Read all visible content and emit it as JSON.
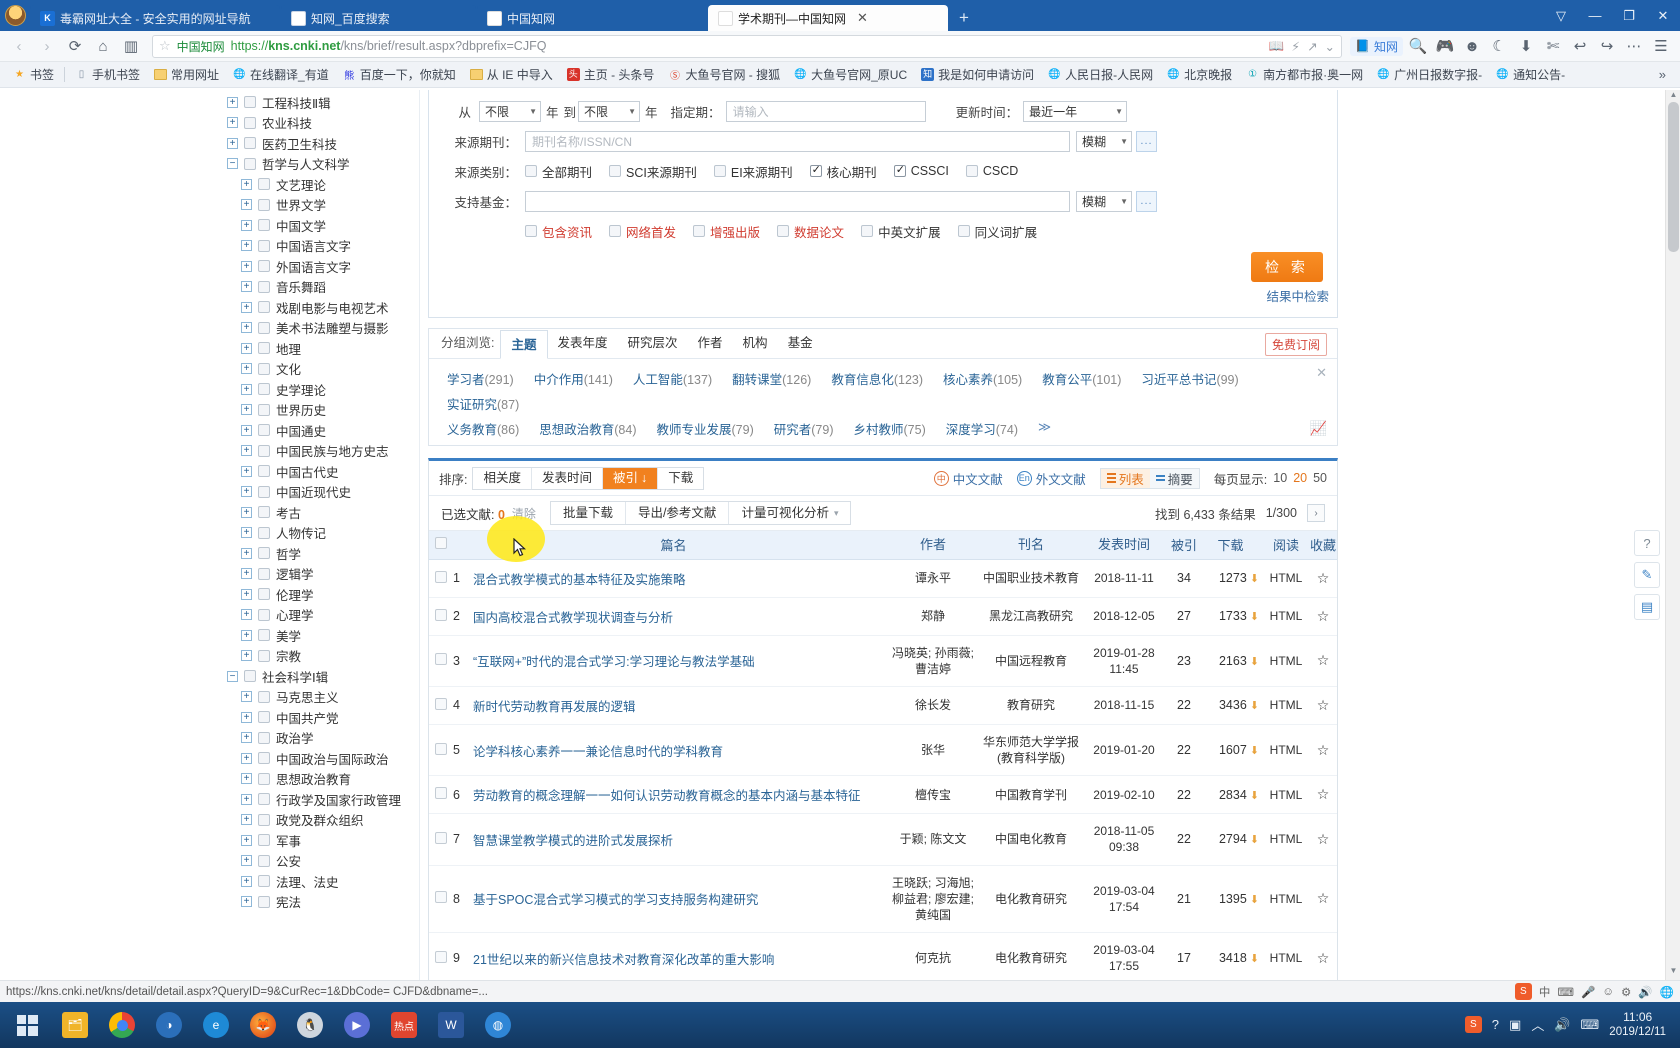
{
  "browser": {
    "tabs": [
      {
        "title": "毒霸网址大全 - 安全实用的网址导航",
        "favicon": "K",
        "active": false
      },
      {
        "title": "知网_百度搜索",
        "favicon": "百",
        "active": false
      },
      {
        "title": "中国知网",
        "favicon": "知",
        "active": false
      },
      {
        "title": "学术期刊—中国知网",
        "favicon": "知",
        "active": true
      }
    ],
    "newtab_label": "+",
    "window_buttons": [
      "⬒",
      "—",
      "❐",
      "✕"
    ],
    "nav": {
      "back": "‹",
      "forward": "›",
      "reload": "⟳",
      "home": "⌂",
      "reader": "▥",
      "star": "☆",
      "site_label": "中国知网",
      "url_scheme": "https://",
      "url_host": "kns.cnki.net",
      "url_path": "/kns/brief/result.aspx?dbprefix=CJFQ",
      "badge_label": "知网",
      "right_icons": [
        "📖",
        "⚡",
        "↗",
        "⌄",
        "🔍",
        "🎮",
        "☻",
        "☾",
        "⬇",
        "✄",
        "↩",
        "↪",
        "⋯",
        "☰"
      ]
    },
    "bookmarks": [
      {
        "label": "书签",
        "icon": "star"
      },
      {
        "label": "手机书签",
        "icon": "phone"
      },
      {
        "label": "常用网址",
        "icon": "folder"
      },
      {
        "label": "在线翻译_有道",
        "icon": "globe"
      },
      {
        "label": "百度一下，你就知",
        "icon": "baidu"
      },
      {
        "label": "从 IE 中导入",
        "icon": "folder"
      },
      {
        "label": "主页 - 头条号",
        "icon": "toutiao"
      },
      {
        "label": "大鱼号官网 - 搜狐",
        "icon": "dayu"
      },
      {
        "label": "大鱼号官网_原UC",
        "icon": "globe"
      },
      {
        "label": "我是如何申请访问",
        "icon": "zhi"
      },
      {
        "label": "人民日报-人民网",
        "icon": "globe"
      },
      {
        "label": "北京晚报",
        "icon": "globe"
      },
      {
        "label": "南方都市报·奥一网",
        "icon": "nandu"
      },
      {
        "label": "广州日报数字报-",
        "icon": "globe"
      },
      {
        "label": "通知公告-",
        "icon": "globe"
      }
    ],
    "bookmarks_overflow": "»"
  },
  "tree": {
    "items": [
      {
        "label": "工程科技Ⅱ辑",
        "level": 0,
        "expander": "+",
        "clipped": true
      },
      {
        "label": "农业科技",
        "level": 0,
        "expander": "+"
      },
      {
        "label": "医药卫生科技",
        "level": 0,
        "expander": "+"
      },
      {
        "label": "哲学与人文科学",
        "level": 0,
        "expander": "−"
      },
      {
        "label": "文艺理论",
        "level": 1,
        "expander": "+"
      },
      {
        "label": "世界文学",
        "level": 1,
        "expander": "+"
      },
      {
        "label": "中国文学",
        "level": 1,
        "expander": "+"
      },
      {
        "label": "中国语言文字",
        "level": 1,
        "expander": "+"
      },
      {
        "label": "外国语言文字",
        "level": 1,
        "expander": "+"
      },
      {
        "label": "音乐舞蹈",
        "level": 1,
        "expander": "+"
      },
      {
        "label": "戏剧电影与电视艺术",
        "level": 1,
        "expander": "+"
      },
      {
        "label": "美术书法雕塑与摄影",
        "level": 1,
        "expander": "+"
      },
      {
        "label": "地理",
        "level": 1,
        "expander": "+"
      },
      {
        "label": "文化",
        "level": 1,
        "expander": "+"
      },
      {
        "label": "史学理论",
        "level": 1,
        "expander": "+"
      },
      {
        "label": "世界历史",
        "level": 1,
        "expander": "+"
      },
      {
        "label": "中国通史",
        "level": 1,
        "expander": "+"
      },
      {
        "label": "中国民族与地方史志",
        "level": 1,
        "expander": "+"
      },
      {
        "label": "中国古代史",
        "level": 1,
        "expander": "+"
      },
      {
        "label": "中国近现代史",
        "level": 1,
        "expander": "+"
      },
      {
        "label": "考古",
        "level": 1,
        "expander": "+"
      },
      {
        "label": "人物传记",
        "level": 1,
        "expander": "+"
      },
      {
        "label": "哲学",
        "level": 1,
        "expander": "+"
      },
      {
        "label": "逻辑学",
        "level": 1,
        "expander": "+"
      },
      {
        "label": "伦理学",
        "level": 1,
        "expander": "+"
      },
      {
        "label": "心理学",
        "level": 1,
        "expander": "+"
      },
      {
        "label": "美学",
        "level": 1,
        "expander": "+"
      },
      {
        "label": "宗教",
        "level": 1,
        "expander": "+"
      },
      {
        "label": "社会科学Ⅰ辑",
        "level": 0,
        "expander": "−"
      },
      {
        "label": "马克思主义",
        "level": 1,
        "expander": "+"
      },
      {
        "label": "中国共产党",
        "level": 1,
        "expander": "+"
      },
      {
        "label": "政治学",
        "level": 1,
        "expander": "+"
      },
      {
        "label": "中国政治与国际政治",
        "level": 1,
        "expander": "+"
      },
      {
        "label": "思想政治教育",
        "level": 1,
        "expander": "+"
      },
      {
        "label": "行政学及国家行政管理",
        "level": 1,
        "expander": "+"
      },
      {
        "label": "政党及群众组织",
        "level": 1,
        "expander": "+"
      },
      {
        "label": "军事",
        "level": 1,
        "expander": "+"
      },
      {
        "label": "公安",
        "level": 1,
        "expander": "+"
      },
      {
        "label": "法理、法史",
        "level": 1,
        "expander": "+"
      },
      {
        "label": "宪法",
        "level": 1,
        "expander": "+"
      }
    ]
  },
  "search_form": {
    "from_label": "从",
    "from_value": "不限",
    "year_label_1": "年",
    "to_label": "到",
    "to_value": "不限",
    "year_label_2": "年",
    "issue_label": "指定期：",
    "issue_placeholder": "请输入",
    "update_label": "更新时间：",
    "update_value": "最近一年",
    "journal_label": "来源期刊：",
    "journal_placeholder": "期刊名称/ISSN/CN",
    "journal_match": "模糊",
    "category_label": "来源类别：",
    "categories": [
      {
        "label": "全部期刊",
        "checked": false
      },
      {
        "label": "SCI来源期刊",
        "checked": false
      },
      {
        "label": "EI来源期刊",
        "checked": false
      },
      {
        "label": "核心期刊",
        "checked": true
      },
      {
        "label": "CSSCI",
        "checked": true
      },
      {
        "label": "CSCD",
        "checked": false
      }
    ],
    "fund_label": "支持基金：",
    "fund_value": "",
    "fund_match": "模糊",
    "options": [
      {
        "label": "包含资讯",
        "checked": false,
        "red": true
      },
      {
        "label": "网络首发",
        "checked": false,
        "red": true
      },
      {
        "label": "增强出版",
        "checked": false,
        "red": true
      },
      {
        "label": "数据论文",
        "checked": false,
        "red": true
      },
      {
        "label": "中英文扩展",
        "checked": false,
        "red": false
      },
      {
        "label": "同义词扩展",
        "checked": false,
        "red": false
      }
    ],
    "search_button": "检 索",
    "refine_link": "结果中检索",
    "dots_label": "..."
  },
  "group_browse": {
    "label": "分组浏览:",
    "tabs": [
      {
        "label": "主题",
        "active": true
      },
      {
        "label": "发表年度",
        "active": false
      },
      {
        "label": "研究层次",
        "active": false
      },
      {
        "label": "作者",
        "active": false
      },
      {
        "label": "机构",
        "active": false
      },
      {
        "label": "基金",
        "active": false
      }
    ],
    "subscribe_label": "免费订阅",
    "close_icon": "✕",
    "chart_icon": "📈",
    "tags": [
      {
        "name": "学习者",
        "count": "(291)"
      },
      {
        "name": "中介作用",
        "count": "(141)"
      },
      {
        "name": "人工智能",
        "count": "(137)"
      },
      {
        "name": "翻转课堂",
        "count": "(126)"
      },
      {
        "name": "教育信息化",
        "count": "(123)"
      },
      {
        "name": "核心素养",
        "count": "(105)"
      },
      {
        "name": "教育公平",
        "count": "(101)"
      },
      {
        "name": "习近平总书记",
        "count": "(99)"
      },
      {
        "name": "实证研究",
        "count": "(87)"
      },
      {
        "name": "义务教育",
        "count": "(86)"
      },
      {
        "name": "思想政治教育",
        "count": "(84)"
      },
      {
        "name": "教师专业发展",
        "count": "(79)"
      },
      {
        "name": "研究者",
        "count": "(79)"
      },
      {
        "name": "乡村教师",
        "count": "(75)"
      },
      {
        "name": "深度学习",
        "count": "(74)"
      }
    ],
    "more": "≫"
  },
  "results_toolbar": {
    "sort_label": "排序:",
    "sort_options": [
      {
        "label": "相关度",
        "active": false
      },
      {
        "label": "发表时间",
        "active": false
      },
      {
        "label": "被引",
        "active": true,
        "arrow": "↓"
      },
      {
        "label": "下载",
        "active": false
      }
    ],
    "lang_cn": "中文文献",
    "lang_cn_icon": "中",
    "lang_en": "外文文献",
    "lang_en_icon": "En",
    "view_list": "列表",
    "view_abstract": "摘要",
    "perpage_label": "每页显示:",
    "perpage_options": [
      {
        "label": "10",
        "active": false
      },
      {
        "label": "20",
        "active": true
      },
      {
        "label": "50",
        "active": false
      }
    ]
  },
  "action_bar": {
    "selected_label": "已选文献:",
    "selected_count": "0",
    "clear_label": "清除",
    "batch_download": "批量下载",
    "export": "导出/参考文献",
    "analysis": "计量可视化分析",
    "analysis_caret": "▾",
    "found_label": "找到 6,433 条结果",
    "page_label": "1/300",
    "next_page": "›"
  },
  "table": {
    "headers": {
      "title": "篇名",
      "author": "作者",
      "journal": "刊名",
      "date": "发表时间",
      "cited": "被引",
      "download": "下载",
      "read": "阅读",
      "favorite": "收藏"
    },
    "rows": [
      {
        "no": "1",
        "title": "混合式教学模式的基本特征及实施策略",
        "author": "谭永平",
        "journal": "中国职业技术教育",
        "date": "2018-11-11",
        "cited": "34",
        "downloads": "1273",
        "read": "HTML",
        "highlighted": true
      },
      {
        "no": "2",
        "title": "国内高校混合式教学现状调查与分析",
        "author": "郑静",
        "journal": "黑龙江高教研究",
        "date": "2018-12-05",
        "cited": "27",
        "downloads": "1733",
        "read": "HTML"
      },
      {
        "no": "3",
        "title": "“互联网+”时代的混合式学习:学习理论与教法学基础",
        "author": "冯晓英; 孙雨薇; 曹洁婷",
        "journal": "中国远程教育",
        "date": "2019-01-28 11:45",
        "cited": "23",
        "downloads": "2163",
        "read": "HTML"
      },
      {
        "no": "4",
        "title": "新时代劳动教育再发展的逻辑",
        "author": "徐长发",
        "journal": "教育研究",
        "date": "2018-11-15",
        "cited": "22",
        "downloads": "3436",
        "read": "HTML"
      },
      {
        "no": "5",
        "title": "论学科核心素养一一兼论信息时代的学科教育",
        "author": "张华",
        "journal": "华东师范大学学报(教育科学版)",
        "date": "2019-01-20",
        "cited": "22",
        "downloads": "1607",
        "read": "HTML"
      },
      {
        "no": "6",
        "title": "劳动教育的概念理解一一如何认识劳动教育概念的基本内涵与基本特征",
        "author": "檀传宝",
        "journal": "中国教育学刊",
        "date": "2019-02-10",
        "cited": "22",
        "downloads": "2834",
        "read": "HTML"
      },
      {
        "no": "7",
        "title": "智慧课堂教学模式的进阶式发展探析",
        "author": "于颖; 陈文文",
        "journal": "中国电化教育",
        "date": "2018-11-05 09:38",
        "cited": "22",
        "downloads": "2794",
        "read": "HTML"
      },
      {
        "no": "8",
        "title": "基于SPOC混合式学习模式的学习支持服务构建研究",
        "author": "王晓跃; 习海旭; 柳益君; 廖宏建; 黄纯国",
        "journal": "电化教育研究",
        "date": "2019-03-04 17:54",
        "cited": "21",
        "downloads": "1395",
        "read": "HTML"
      },
      {
        "no": "9",
        "title": "21世纪以来的新兴信息技术对教育深化改革的重大影响",
        "author": "何克抗",
        "journal": "电化教育研究",
        "date": "2019-03-04 17:55",
        "cited": "17",
        "downloads": "3418",
        "read": "HTML"
      }
    ]
  },
  "right_toolbar": [
    {
      "icon": "?",
      "name": "help"
    },
    {
      "icon": "✎",
      "name": "feedback"
    },
    {
      "icon": "▤",
      "name": "notes"
    }
  ],
  "status_bar": {
    "url": "https://kns.cnki.net/kns/detail/detail.aspx?QueryID=9&CurRec=1&DbCode= CJFD&dbname=...",
    "tray_icons": [
      "中",
      "⌨",
      "🎤",
      "☺",
      "⚙",
      "🔊",
      "🌐"
    ],
    "ime_label": "中"
  },
  "taskbar": {
    "apps": [
      "win",
      "folder",
      "chrome",
      "ie-blue",
      "ie",
      "firefox",
      "qq",
      "player",
      "hot",
      "word",
      "browser"
    ],
    "time": "11:06",
    "date": "2019/12/11",
    "tray": [
      "S",
      "?",
      "▣",
      "☰",
      "🔊",
      "⌨"
    ]
  }
}
